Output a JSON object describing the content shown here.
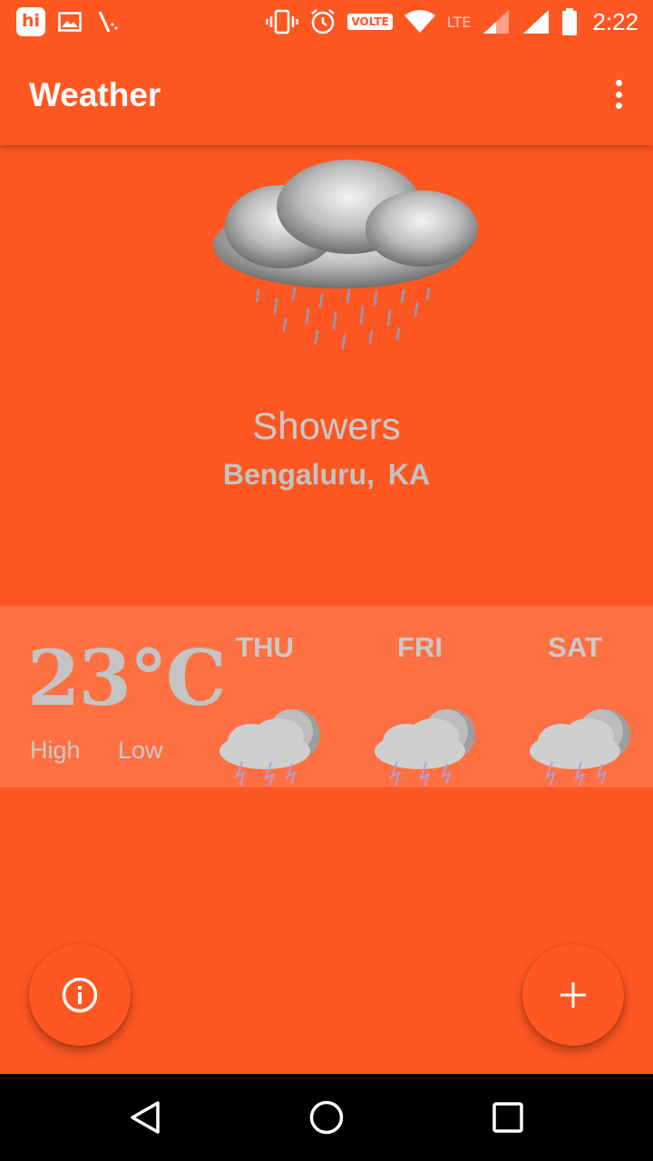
{
  "status_bar": {
    "hi_badge": "hi",
    "volte": "VOLTE",
    "lte": "LTE",
    "time": "2:22",
    "icons": [
      "hike-icon",
      "gallery-icon",
      "wand-icon",
      "vibrate-icon",
      "alarm-icon",
      "wifi-icon",
      "signal-icon",
      "signal-icon",
      "battery-icon"
    ]
  },
  "app_bar": {
    "title": "Weather",
    "overflow_icon": "more-vert-icon"
  },
  "current": {
    "condition": "Showers",
    "location": "Bengaluru,  KA",
    "icon": "rain-cloud-icon",
    "temperature": "23°C",
    "high_label": "High",
    "low_label": "Low"
  },
  "forecast": [
    {
      "day": "THU",
      "icon": "thunderstorm-night-icon"
    },
    {
      "day": "FRI",
      "icon": "thunderstorm-night-icon"
    },
    {
      "day": "SAT",
      "icon": "thunderstorm-night-icon"
    }
  ],
  "fabs": {
    "info_icon": "info-icon",
    "add_icon": "add-icon"
  },
  "colors": {
    "primary": "#FF5722",
    "band": "#FF7043",
    "muted_text": "#C9C9C9"
  }
}
